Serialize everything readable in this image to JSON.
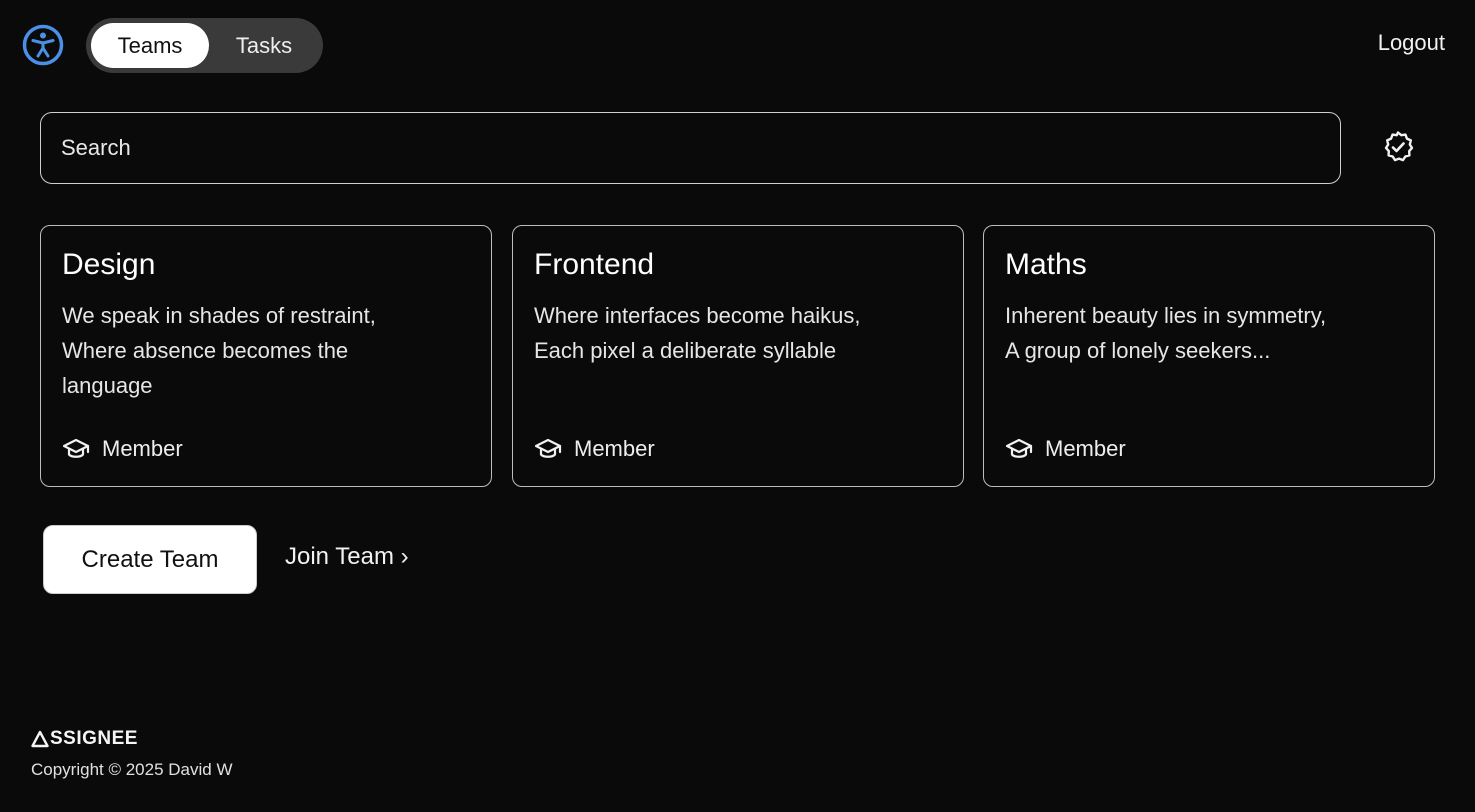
{
  "nav": {
    "tabs": [
      {
        "label": "Teams",
        "active": true
      },
      {
        "label": "Tasks",
        "active": false
      }
    ],
    "logout_label": "Logout",
    "accessibility_icon": "accessibility-icon"
  },
  "search": {
    "placeholder": "Search",
    "value": "",
    "filter_icon": "verified-badge-icon"
  },
  "teams": [
    {
      "name": "Design",
      "description": [
        "We speak in shades of restraint,",
        "Where absence becomes the",
        "language"
      ],
      "role": "Member",
      "role_icon": "graduation-cap-icon"
    },
    {
      "name": "Frontend",
      "description": [
        "Where interfaces become haikus,",
        "Each pixel a deliberate syllable"
      ],
      "role": "Member",
      "role_icon": "graduation-cap-icon"
    },
    {
      "name": "Maths",
      "description": [
        "Inherent beauty lies in symmetry,",
        "A group of lonely seekers..."
      ],
      "role": "Member",
      "role_icon": "graduation-cap-icon"
    }
  ],
  "actions": {
    "create_label": "Create Team",
    "join_label": "Join Team ›"
  },
  "footer": {
    "logo_text": "SSIGNEE",
    "copyright": "Copyright © 2025 David W"
  },
  "colors": {
    "background": "#0a0a0a",
    "accent": "#3b82f6",
    "text": "#f2f2f2"
  }
}
